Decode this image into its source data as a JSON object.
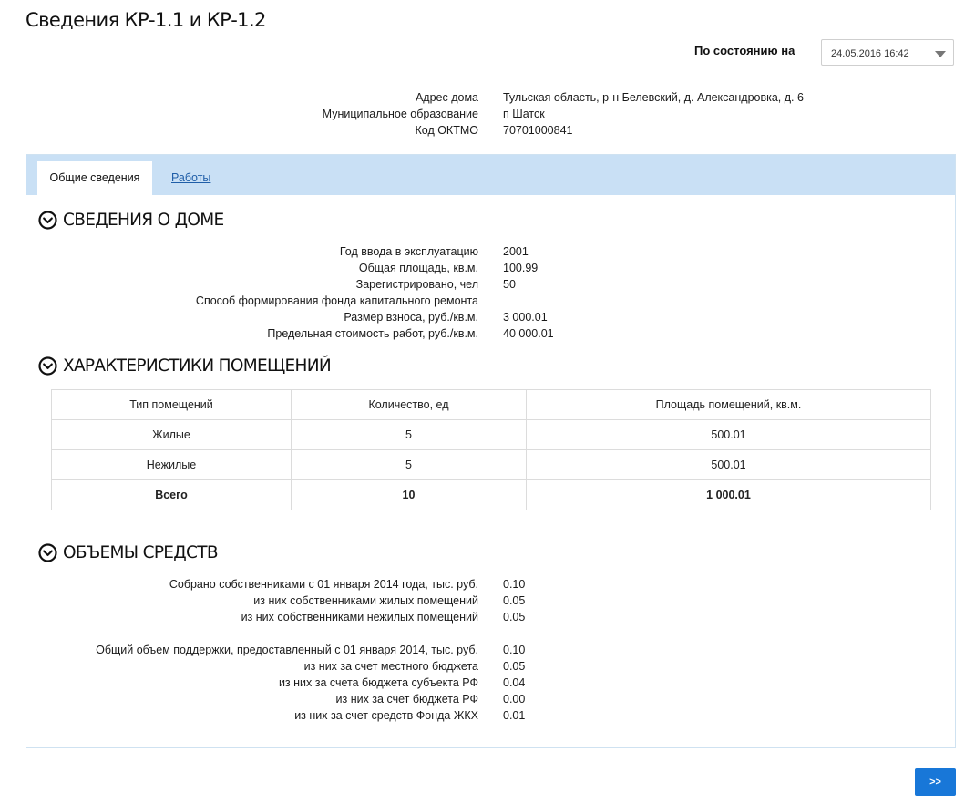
{
  "page": {
    "title": "Сведения КР-1.1 и КР-1.2"
  },
  "state": {
    "label": "По состоянию на",
    "date_value": "24.05.2016 16:42"
  },
  "address": {
    "house_label": "Адрес дома",
    "house_value": "Тульская область, р-н Белевский, д. Александровка, д. 6",
    "municipal_label": "Муниципальное образование",
    "municipal_value": "п Шатск",
    "oktmo_label": "Код ОКТМО",
    "oktmo_value": "70701000841"
  },
  "tabs": [
    {
      "label": "Общие сведения",
      "active": true
    },
    {
      "label": "Работы",
      "active": false
    }
  ],
  "house_section": {
    "title": "СВЕДЕНИЯ О ДОМЕ",
    "rows": [
      {
        "label": "Год ввода в эксплуатацию",
        "value": "2001"
      },
      {
        "label": "Общая площадь, кв.м.",
        "value": "100.99"
      },
      {
        "label": "Зарегистрировано, чел",
        "value": "50"
      },
      {
        "label": "Способ формирования фонда капитального ремонта",
        "value": ""
      },
      {
        "label": "Размер взноса, руб./кв.м.",
        "value": "3 000.01"
      },
      {
        "label": "Предельная стоимость работ, руб./кв.м.",
        "value": "40 000.01"
      }
    ]
  },
  "rooms_section": {
    "title": "ХАРАКТЕРИСТИКИ ПОМЕЩЕНИЙ",
    "columns": [
      "Тип помещений",
      "Количество, ед",
      "Площадь помещений, кв.м."
    ],
    "rows": [
      [
        "Жилые",
        "5",
        "500.01"
      ],
      [
        "Нежилые",
        "5",
        "500.01"
      ]
    ],
    "total": [
      "Всего",
      "10",
      "1 000.01"
    ]
  },
  "funds_section": {
    "title": "ОБЪЕМЫ СРЕДСТВ",
    "owners": [
      {
        "label": "Собрано собственниками с 01 января 2014 года, тыс. руб.",
        "value": "0.10"
      },
      {
        "label": "из них собственниками жилых помещений",
        "value": "0.05"
      },
      {
        "label": "из них собственниками нежилых помещений",
        "value": "0.05"
      }
    ],
    "support": [
      {
        "label": "Общий объем поддержки, предоставленный с 01 января 2014, тыс. руб.",
        "value": "0.10"
      },
      {
        "label": "из них за счет местного бюджета",
        "value": "0.05"
      },
      {
        "label": "из них за счета бюджета субъекта РФ",
        "value": "0.04"
      },
      {
        "label": "из них за счет бюджета РФ",
        "value": "0.00"
      },
      {
        "label": "из них за счет средств Фонда ЖКХ",
        "value": "0.01"
      }
    ]
  },
  "footer": {
    "next_label": ">>"
  }
}
